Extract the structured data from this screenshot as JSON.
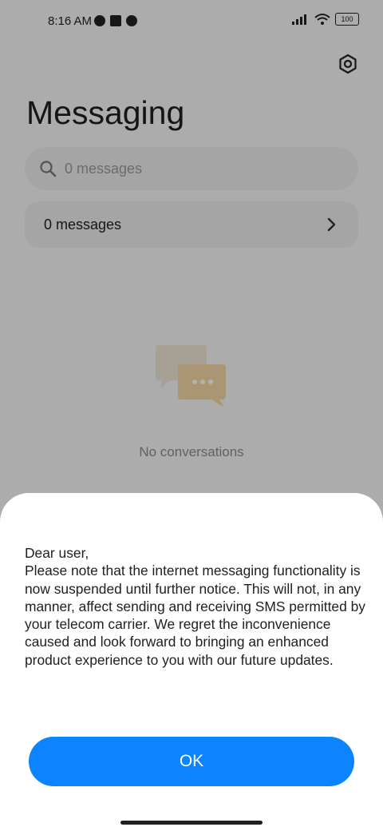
{
  "status_bar": {
    "time": "8:16 AM",
    "battery": "100"
  },
  "header": {
    "title": "Messaging"
  },
  "search": {
    "placeholder": "0 messages"
  },
  "messages_row": {
    "label": "0 messages"
  },
  "empty_state": {
    "text": "No conversations"
  },
  "dialog": {
    "body": "Dear user,\nPlease note that the internet messaging functionality is now suspended until further notice. This will not, in any manner, affect sending and receiving SMS permitted by your telecom carrier. We regret the inconvenience caused and look forward to bringing an enhanced product experience to you with our future updates.",
    "ok_label": "OK"
  },
  "colors": {
    "accent": "#0d84ff",
    "scrim": "rgba(0,0,0,0.30)"
  },
  "icons": [
    "settings-icon",
    "search-icon",
    "chevron-right-icon",
    "chat-bubbles-icon",
    "signal-icon",
    "wifi-icon",
    "battery-icon"
  ]
}
